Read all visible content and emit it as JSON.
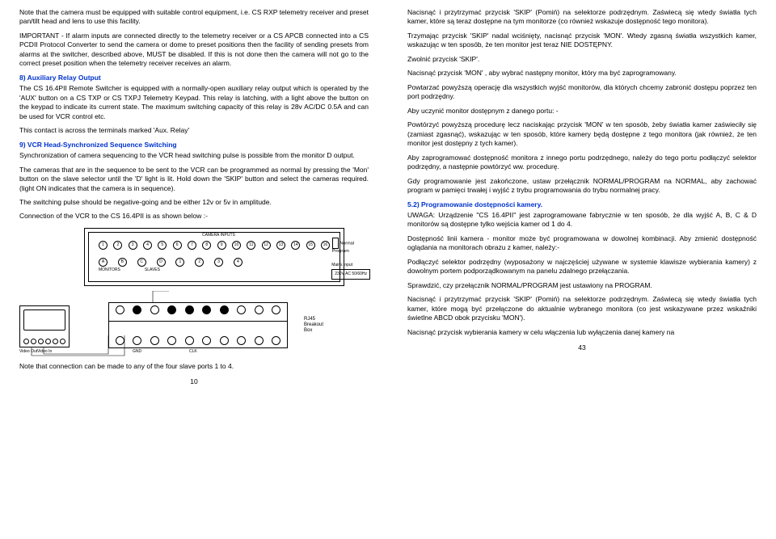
{
  "left": {
    "intro1": "Note that the camera must be equipped with suitable control equipment, i.e. CS RXP telemetry receiver and preset pan/tilt head and lens to use this facility.",
    "intro2": "IMPORTANT - If alarm inputs are connected directly to the telemetry receiver or a CS APCB connected into a CS PCDII Protocol Converter to send the camera or dome to preset positions then the facility of sending presets from alarms at the switcher, described above, MUST be disabled. If this is not done then the camera will not go to the correct preset position when the telemetry receiver receives an alarm.",
    "h8": "8) Auxiliary Relay Output",
    "p8a": "The CS 16.4PII Remote Switcher is equipped with a normally-open auxiliary relay output which is operated by the 'AUX' button on a CS TXP or CS TXPJ Telemetry Keypad. This relay is latching, with a light above the button on the keypad to indicate its current state. The maximum switching capacity of this relay is 28v AC/DC 0.5A and can be used for VCR control etc.",
    "p8b": "This contact is across the terminals marked 'Aux. Relay'",
    "h9": "9) VCR Head-Synchronized Sequence Switching",
    "p9a": "Synchronization of camera sequencing to the VCR head switching pulse is possible from the  monitor D output.",
    "p9b": "The cameras that are in the sequence to be sent to the VCR can be programmed as normal by pressing the 'Mon' button on the slave selector until the 'D' light is lit. Hold down the 'SKIP' button and select the cameras required. (light ON indicates that the camera is in sequence).",
    "p9c": "The switching pulse should be negative-going and be either 12v or 5v in amplitude.",
    "p9d": "Connection of the VCR to the CS 16.4PII is as shown below :-",
    "p9e": "Note that connection can be made to any of the four slave ports 1 to 4.",
    "diag": {
      "camera_inputs": "CAMERA INPUTS",
      "normal": "Normal",
      "program": "Program",
      "mains_input": "Mains Input",
      "mains": "230V AC 50/60Hz",
      "monitors": "MONITORS",
      "slaves": "SLAVES",
      "rj": "RJ45\nBreakout\nBox",
      "video_out": "Video\nOut",
      "video_in": "Video\nIn",
      "gnd": "GND",
      "clk": "CLK"
    },
    "page": "10"
  },
  "right": {
    "p1": "Nacisnąć i przytrzymać przycisk 'SKIP' (Pomiń) na selektorze podrzędnym. Zaświecą się wtedy światła tych kamer, które są teraz dostępne na tym monitorze (co również wskazuje dostępność tego monitora).",
    "p2": "Trzymając przycisk 'SKIP' nadal wciśnięty, nacisnąć przycisk 'MON'. Wtedy zgasną światła wszystkich kamer, wskazując w ten sposób, że ten monitor jest teraz NIE DOSTĘPNY.",
    "p3": "Zwolnić przycisk 'SKIP'.",
    "p4": "Nacisnąć przycisk 'MON' , aby wybrać następny monitor, który ma być zaprogramowany.",
    "p5": "Powtarzać powyższą operację dla wszystkich wyjść monitorów, dla których chcemy zabronić dostępu poprzez ten port podrzędny.",
    "p6": "Aby uczynić monitor dostępnym z danego portu: -",
    "p6a": "Powtórzyć powyższą procedurę lecz naciskając przycisk 'MON' w ten sposób, żeby światła kamer zaświeciły się (zamiast zgasnąć), wskazując w ten sposób, które kamery będą dostępne z tego monitora (jak również, że ten monitor jest dostępny z tych kamer).",
    "p7": "Aby zaprogramować dostępność monitora z innego portu podrzędnego, należy do tego portu podłączyć selektor podrzędny, a następnie powtórzyć ww. procedurę.",
    "p8": "Gdy programowanie jest zakończone, ustaw przełącznik NORMAL/PROGRAM na NORMAL, aby zachować program w pamięci trwałej i wyjść z trybu programowania do trybu normalnej pracy.",
    "h52": "5.2) Programowanie dostępności kamery.",
    "p9": "UWAGA: Urządzenie \"CS 16.4PII\" jest zaprogramowane fabrycznie w ten sposób, że dla wyjść A, B, C & D monitorów są dostępne tylko wejścia kamer od 1 do 4.",
    "p10": "Dostępność linii kamera - monitor może być programowana w dowolnej kombinacji. Aby zmienić dostępność oglądania na monitorach obrazu z kamer, należy:-",
    "p11": "Podłączyć selektor podrzędny (wyposażony w najczęściej używane w systemie klawisze wybierania kamery) z dowolnym portem podporządkowanym na panelu zdalnego przełączania.",
    "p12": "Sprawdzić, czy przełącznik  NORMAL/PROGRAM jest ustawiony na PROGRAM.",
    "p13": "Nacisnąć i przytrzymać przycisk 'SKIP' (Pomiń) na selektorze podrzędnym. Zaświecą się wtedy światła tych kamer, które mogą być przełączone do aktualnie wybranego monitora (co jest wskazywane przez wskaźniki świetlne ABCD obok przycisku 'MON').",
    "p14": "Nacisnąć przycisk wybierania kamery w celu włączenia lub wyłączenia danej kamery na",
    "page": "43"
  }
}
